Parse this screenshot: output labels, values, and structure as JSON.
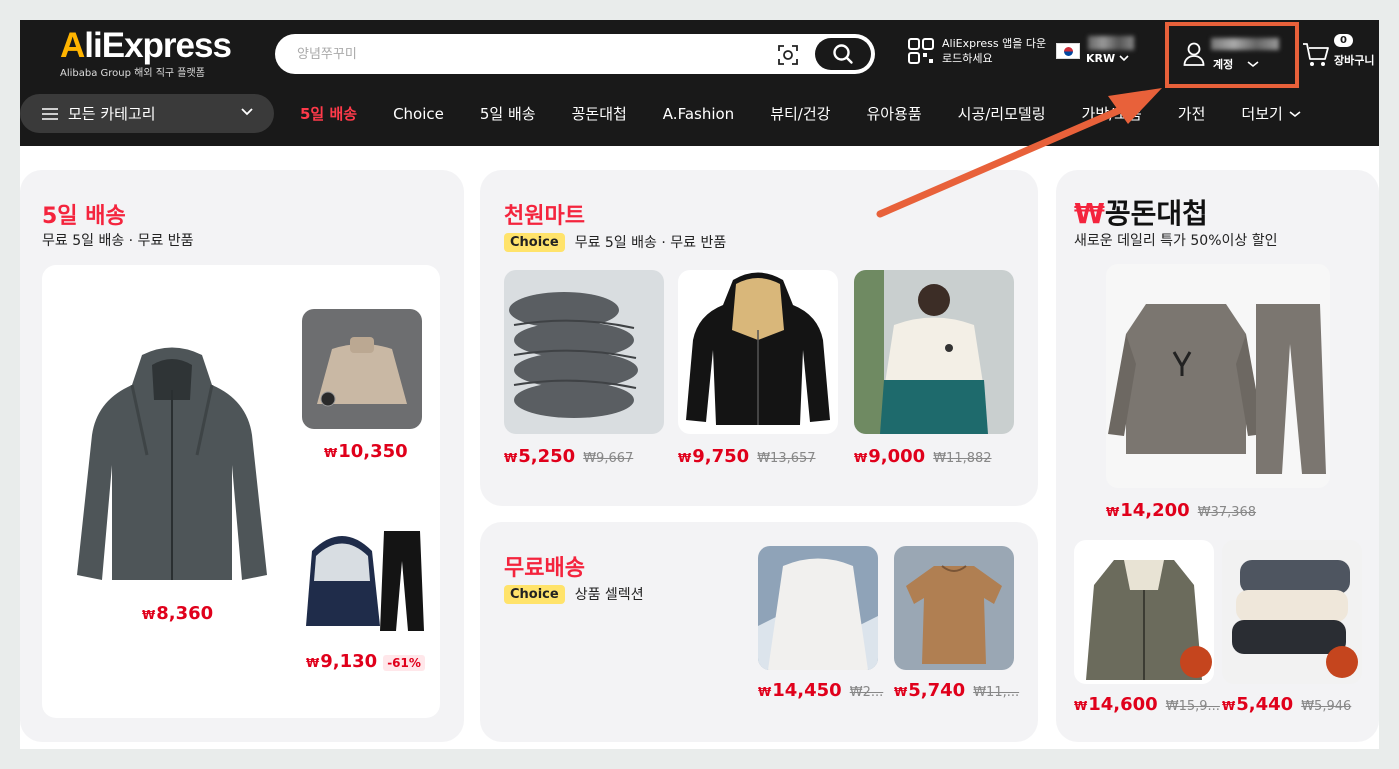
{
  "header": {
    "logo_text_a": "A",
    "logo_text_rest": "liExpress",
    "logo_sub": "Alibaba Group 해외 직구 플랫폼",
    "search_placeholder": "양념쭈꾸미",
    "app_download": "AliExpress 앱을 다운로드하세요",
    "currency": "KRW",
    "account_label": "계정",
    "cart_count": "0",
    "cart_label": "장바구니"
  },
  "nav": {
    "all_categories": "모든 카테고리",
    "items": [
      "5일 배송",
      "Choice",
      "5일 배송",
      "꽁돈대첩",
      "A.Fashion",
      "뷰티/건강",
      "유아용품",
      "시공/리모델링",
      "가방/소품",
      "가전"
    ],
    "more": "더보기"
  },
  "sections": {
    "fiveday": {
      "title": "5일 배송",
      "subtitle": "무료 5일 배송 · 무료 반품",
      "main_price": "8,360",
      "items": [
        {
          "price": "10,350"
        },
        {
          "price": "9,130",
          "discount": "-61%"
        }
      ]
    },
    "thousand": {
      "title": "천원마트",
      "tag": "Choice",
      "subtitle": "무료 5일 배송 · 무료 반품",
      "items": [
        {
          "price": "5,250",
          "old": "₩9,667"
        },
        {
          "price": "9,750",
          "old": "₩13,657"
        },
        {
          "price": "9,000",
          "old": "₩11,882"
        }
      ]
    },
    "freeship": {
      "title": "무료배송",
      "tag": "Choice",
      "subtitle": "상품 셀렉션",
      "items": [
        {
          "price": "14,450",
          "old": "₩2..."
        },
        {
          "price": "5,740",
          "old": "₩11,..."
        }
      ]
    },
    "kkongdon": {
      "title_mark": "₩",
      "title": "꽁돈대첩",
      "subtitle": "새로운 데일리 특가 50%이상 할인",
      "main_price": "14,200",
      "main_old": "₩37,368",
      "items": [
        {
          "price": "14,600",
          "old": "₩15,9..."
        },
        {
          "price": "5,440",
          "old": "₩5,946"
        }
      ]
    }
  },
  "currency_symbol": "₩",
  "colors": {
    "accent_red": "#f4243d",
    "price_red": "#e0001b",
    "highlight_orange": "#e8613a",
    "topbar": "#191919"
  }
}
